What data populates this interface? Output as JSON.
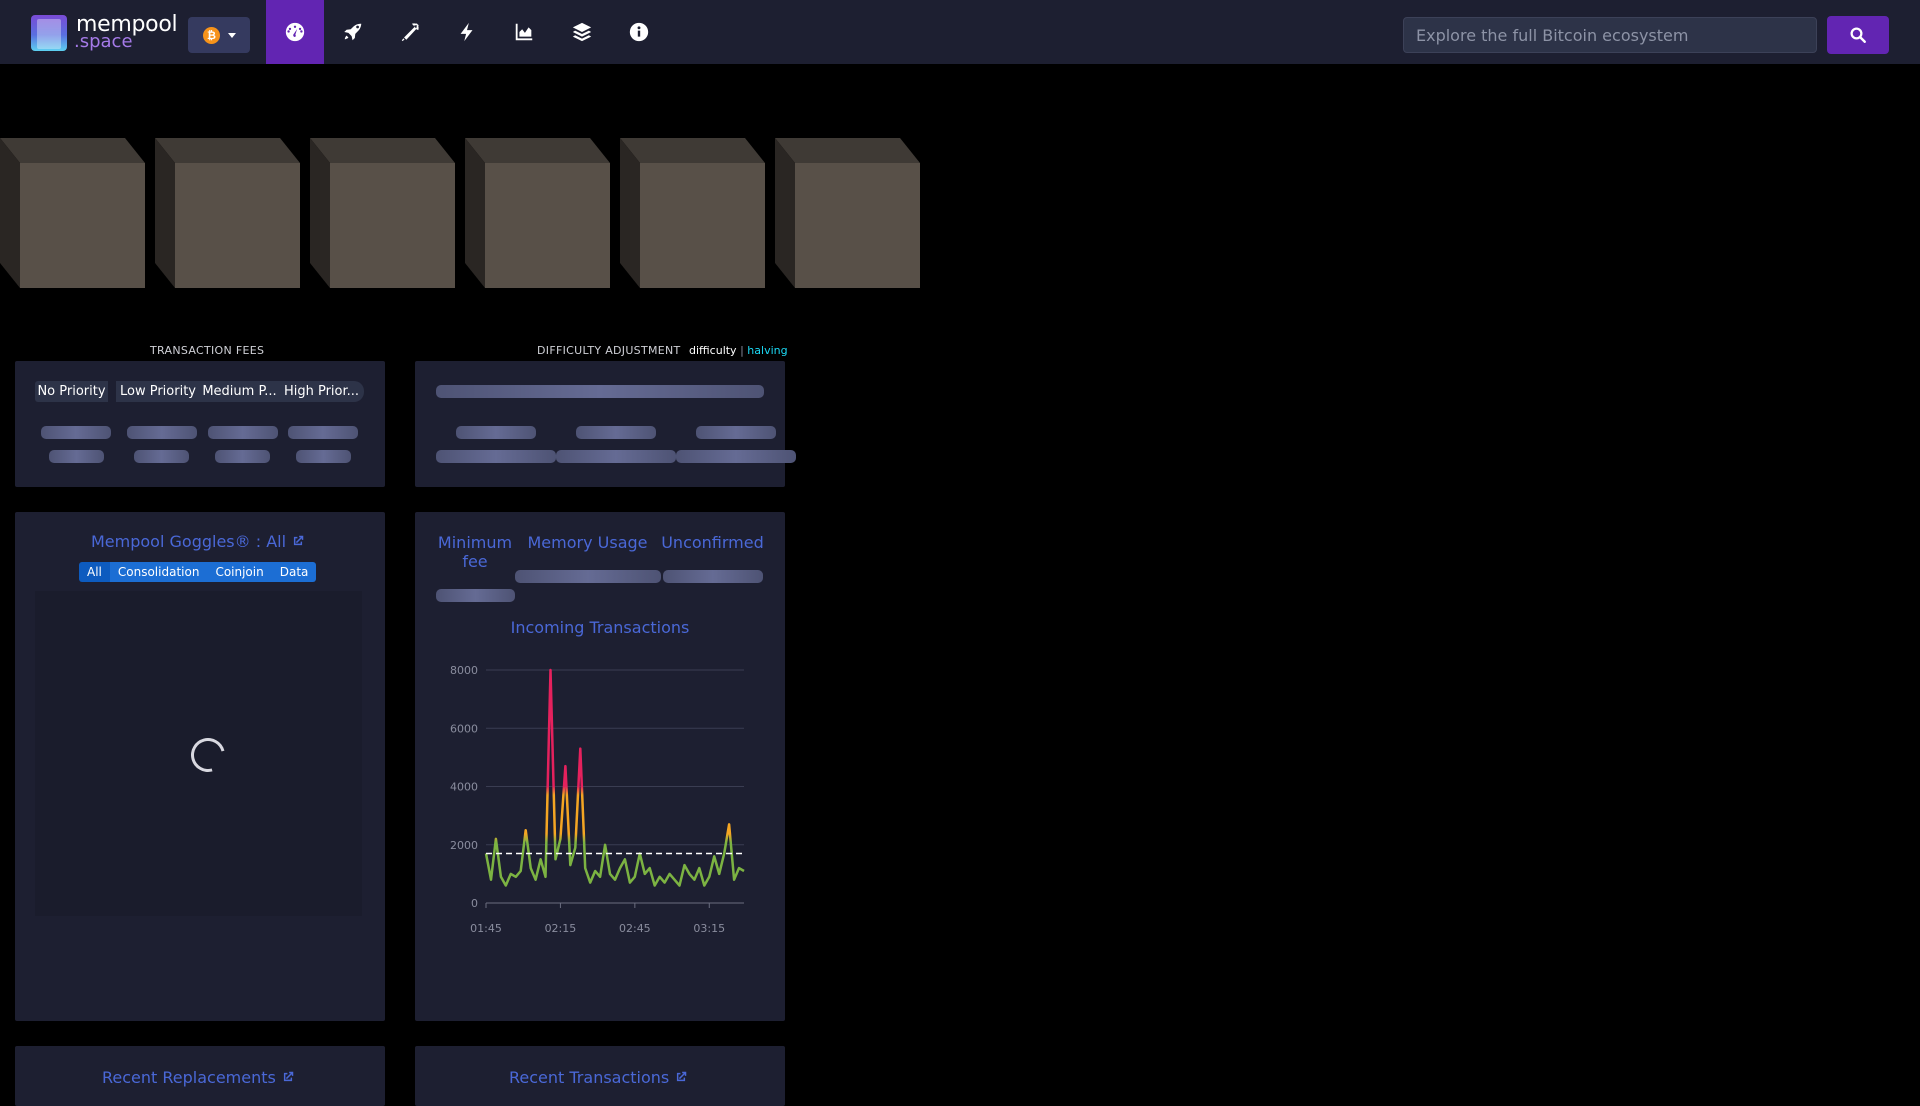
{
  "nav": {
    "logo_line1": "mempool",
    "logo_line2": ".space",
    "network_symbol": "₿",
    "icons": [
      "dashboard-icon",
      "rocket-icon",
      "pickaxe-icon",
      "lightning-icon",
      "chart-icon",
      "layers-icon",
      "info-icon"
    ],
    "active_icon": "dashboard-icon",
    "search_placeholder": "Explore the full Bitcoin ecosystem"
  },
  "fees": {
    "section_title": "TRANSACTION FEES",
    "tabs": [
      "No Priority",
      "Low Priority",
      "Medium P...",
      "High Prior..."
    ]
  },
  "difficulty": {
    "section_title": "DIFFICULTY ADJUSTMENT",
    "toggle_difficulty": "difficulty",
    "toggle_separator": "|",
    "toggle_halving": "halving"
  },
  "goggles": {
    "title": "Mempool Goggles® : All",
    "filters": [
      "All",
      "Consolidation",
      "Coinjoin",
      "Data"
    ],
    "selected": "All"
  },
  "mempool_stats": {
    "min_fee_label_line1": "Minimum",
    "min_fee_label_line2": "fee",
    "memory_label": "Memory Usage",
    "unconfirmed_label": "Unconfirmed"
  },
  "recent": {
    "replacements": "Recent Replacements",
    "transactions": "Recent Transactions"
  },
  "colors": {
    "nav_bg": "#1d1f31",
    "accent": "#6225b2",
    "link": "#4a68d7",
    "halving": "#1bd8f4",
    "low": "#7cb342",
    "mid": "#f5a623",
    "high": "#e5215d"
  },
  "chart_data": {
    "type": "line",
    "title": "Incoming Transactions",
    "ylim": [
      0,
      8000
    ],
    "yticks": [
      0,
      2000,
      4000,
      6000,
      8000
    ],
    "xticks": [
      "01:45",
      "02:15",
      "02:45",
      "03:15"
    ],
    "x": [
      "01:45",
      "01:47",
      "01:49",
      "01:51",
      "01:53",
      "01:55",
      "01:57",
      "01:59",
      "02:01",
      "02:03",
      "02:05",
      "02:07",
      "02:09",
      "02:11",
      "02:13",
      "02:15",
      "02:17",
      "02:19",
      "02:21",
      "02:23",
      "02:25",
      "02:27",
      "02:29",
      "02:31",
      "02:33",
      "02:35",
      "02:37",
      "02:39",
      "02:41",
      "02:43",
      "02:45",
      "02:47",
      "02:49",
      "02:51",
      "02:53",
      "02:55",
      "02:57",
      "02:59",
      "03:01",
      "03:03",
      "03:05",
      "03:07",
      "03:09",
      "03:11",
      "03:13",
      "03:15",
      "03:17",
      "03:19",
      "03:21",
      "03:23",
      "03:25",
      "03:27",
      "03:29"
    ],
    "series": [
      {
        "values": [
          1700,
          800,
          2200,
          900,
          600,
          1000,
          900,
          1100,
          2500,
          1200,
          800,
          1500,
          900,
          8000,
          1500,
          2200,
          4700,
          1300,
          1900,
          5300,
          1200,
          700,
          1100,
          900,
          2000,
          1000,
          800,
          1200,
          1500,
          700,
          900,
          1700,
          1000,
          1200,
          600,
          900,
          700,
          1000,
          800,
          600,
          1300,
          1000,
          800,
          1200,
          600,
          900,
          1600,
          1000,
          1700,
          2700,
          800,
          1200,
          1100
        ]
      }
    ],
    "threshold": 1700
  }
}
